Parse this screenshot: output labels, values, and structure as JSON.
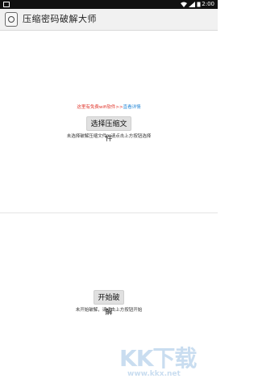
{
  "status_bar": {
    "time": "2:00",
    "icons": [
      "app-notification-icon",
      "wifi-icon",
      "signal-icon",
      "battery-icon"
    ]
  },
  "app_bar": {
    "title": "压缩密码破解大师",
    "logo_icon": "lock-icon"
  },
  "promo": {
    "text": "这里有免费wifi软件>>",
    "link": "直看详情"
  },
  "select_section": {
    "button_label": "选择压缩文件",
    "hint": "未选择破解压缩文件，请点击上方按钮选择"
  },
  "crack_section": {
    "button_label": "开始破解",
    "hint": "未开始破解，请点击上方按钮开始"
  },
  "watermark": {
    "logo": "KK下载",
    "url": "www.kkx.net"
  },
  "colors": {
    "promo_text": "#e0352b",
    "promo_link": "#2a8ad8",
    "button_bg": "#e0e0e0",
    "app_bar_bg": "#f1f1f1"
  }
}
